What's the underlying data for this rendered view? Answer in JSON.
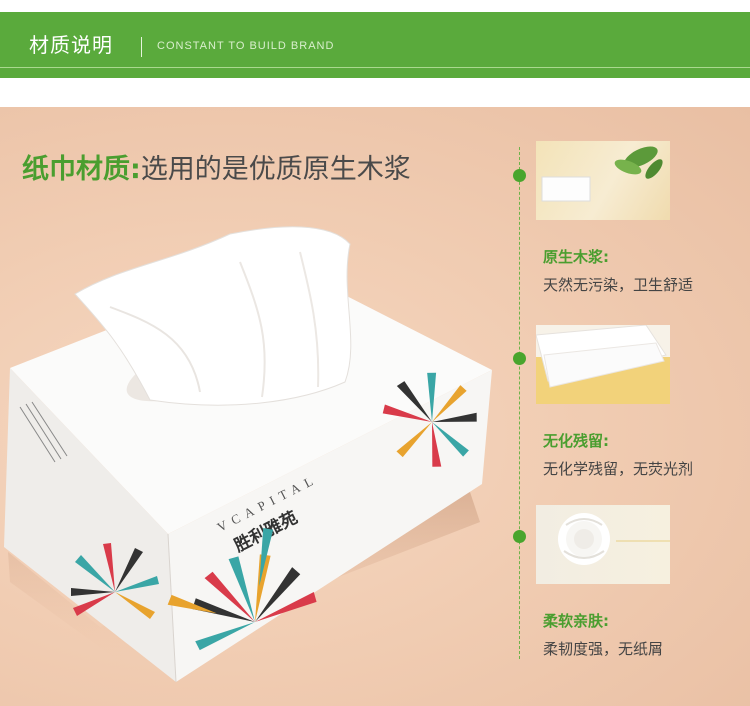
{
  "header": {
    "title": "材质说明",
    "subtitle": "CONSTANT TO BUILD BRAND"
  },
  "headline": {
    "green": "纸巾材质:",
    "dark": "选用的是优质原生木浆"
  },
  "product": {
    "brand_en": "VCAPITAL",
    "brand_cn": "胜利雅苑"
  },
  "features": [
    {
      "title": "原生木浆:",
      "desc": "天然无污染，卫生舒适"
    },
    {
      "title": "无化残留:",
      "desc": "无化学残留，无荧光剂"
    },
    {
      "title": "柔软亲肤:",
      "desc": "柔韧度强，无纸屑"
    }
  ],
  "colors": {
    "banner": "#5aaa3c",
    "accent_green": "#4a9e2f",
    "background": "#f1cdb3"
  }
}
